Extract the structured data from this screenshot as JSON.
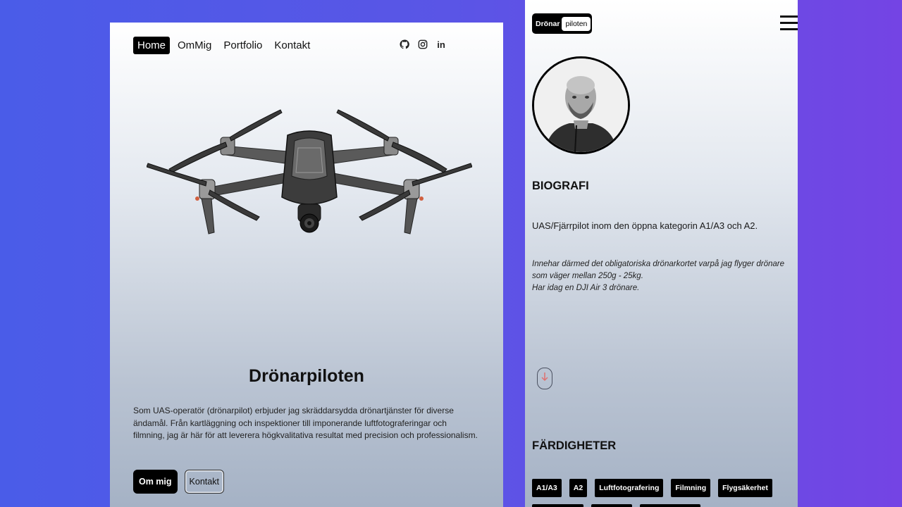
{
  "left": {
    "nav": [
      {
        "label": "Home",
        "active": true
      },
      {
        "label": "OmMig",
        "active": false
      },
      {
        "label": "Portfolio",
        "active": false
      },
      {
        "label": "Kontakt",
        "active": false
      }
    ],
    "socials": [
      "github-icon",
      "instagram-icon",
      "linkedin-icon"
    ],
    "linkedin_glyph": "in",
    "hero_title": "Drönarpiloten",
    "hero_text": "Som UAS-operatör (drönarpilot) erbjuder jag skräddarsydda drönartjänster för diverse ändamål. Från kartläggning och inspektioner till imponerande luftfotograferingar och filmning, jag är här för att leverera högkvalitativa resultat med precision och professionalism.",
    "buttons": {
      "primary": "Om mig",
      "secondary": "Kontakt"
    }
  },
  "right": {
    "logo": {
      "part1": "Drönar",
      "part2": "piloten"
    },
    "biography_title": "BIOGRAFI",
    "bio_main": "UAS/Fjärrpilot inom den öppna kategorin A1/A3 och A2.",
    "bio_italic_1": "Innehar därmed det obligatoriska drönarkortet varpå jag flyger drönare som väger mellan 250g - 25kg.",
    "bio_italic_2": "Har idag en DJI Air 3 drönare.",
    "skills_title": "FÄRDIGHETER",
    "skills": [
      "A1/A3",
      "A2",
      "Luftfotografering",
      "Filmning",
      "Flygsäkerhet"
    ]
  },
  "colors": {
    "background_left": "#4a5ce8",
    "background_right": "#7444e4",
    "accent": "#000000",
    "scroll_arrow": "#e07070"
  }
}
